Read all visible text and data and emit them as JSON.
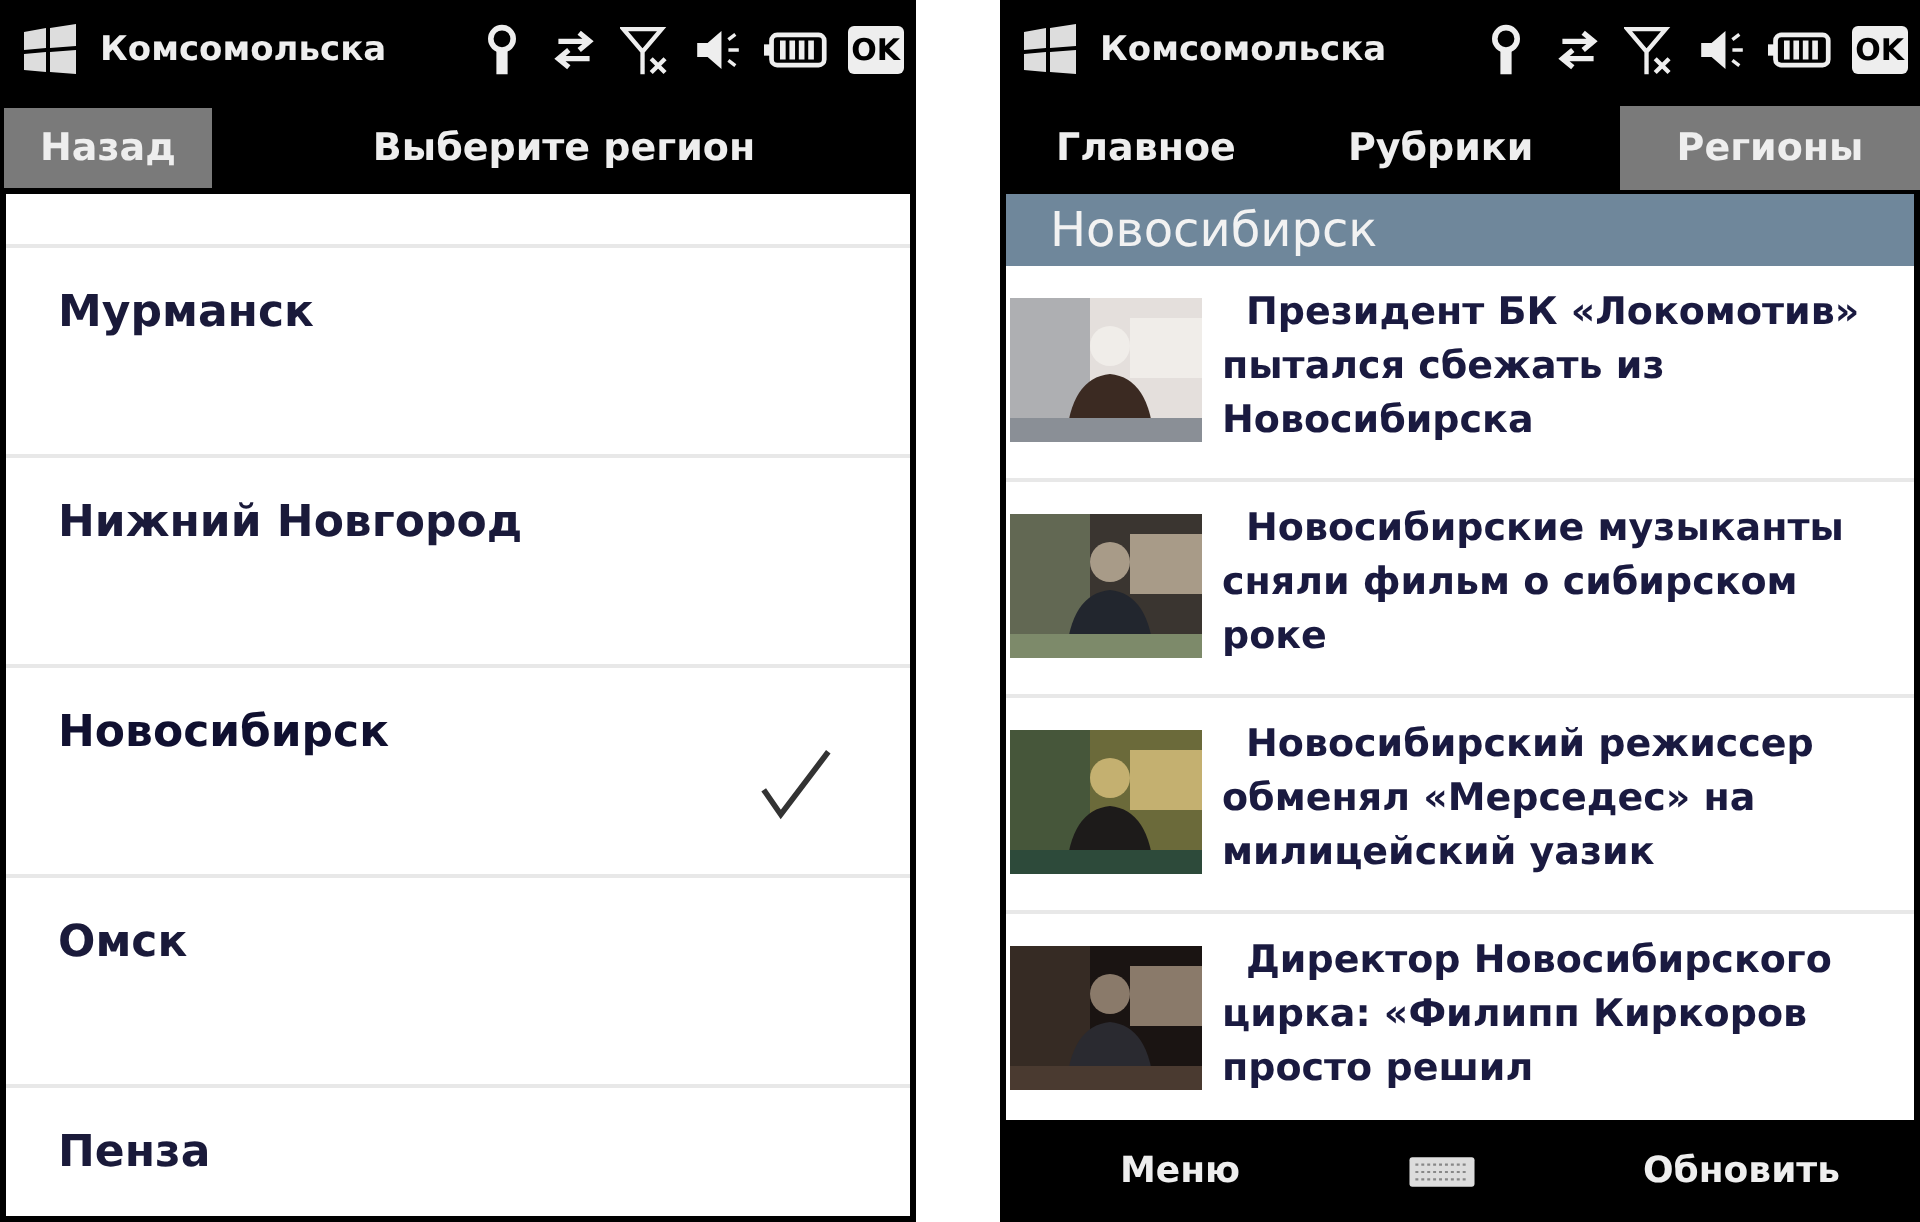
{
  "left_screen": {
    "status_bar": {
      "title": "Комсомольска",
      "ok": "OK"
    },
    "header": {
      "back": "Назад",
      "title": "Выберите регион"
    },
    "regions": [
      {
        "name": "Мурманск",
        "selected": false
      },
      {
        "name": "Нижний Новгород",
        "selected": false
      },
      {
        "name": "Новосибирск",
        "selected": true
      },
      {
        "name": "Омск",
        "selected": false
      },
      {
        "name": "Пенза",
        "selected": false
      }
    ]
  },
  "right_screen": {
    "status_bar": {
      "title": "Комсомольска",
      "ok": "OK"
    },
    "tabs": [
      {
        "label": "Главное",
        "selected": false
      },
      {
        "label": "Рубрики",
        "selected": false
      },
      {
        "label": "Регионы",
        "selected": true
      }
    ],
    "section": "Новосибирск",
    "news": [
      {
        "headline": "Президент БК «Локомотив» пытался сбежать из Новосибирска"
      },
      {
        "headline": "Новосибирские музыканты сняли фильм о сибирском роке"
      },
      {
        "headline": "Новосибирский режиссер обменял «Мерседес» на милицейский уазик"
      },
      {
        "headline": "Директор Новосибирского цирка: «Филипп Киркоров просто решил"
      }
    ],
    "softkeys": {
      "left": "Меню",
      "right": "Обновить"
    }
  }
}
